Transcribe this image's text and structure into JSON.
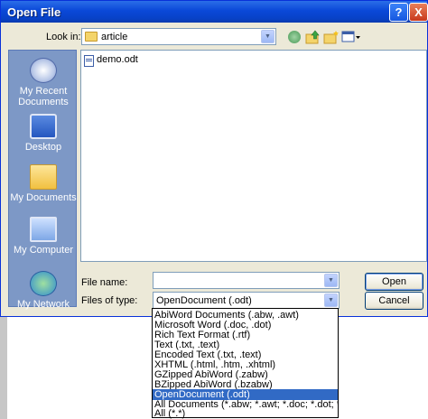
{
  "window": {
    "title": "Open File",
    "help_symbol": "?",
    "close_symbol": "X"
  },
  "lookin": {
    "label": "Look in:",
    "value": "article"
  },
  "toolbar": {
    "icons": [
      "back-icon",
      "up-folder-icon",
      "new-folder-icon",
      "view-menu-icon"
    ]
  },
  "places": [
    {
      "label": "My Recent Documents",
      "icon": "recent-documents-icon"
    },
    {
      "label": "Desktop",
      "icon": "desktop-icon"
    },
    {
      "label": "My Documents",
      "icon": "my-documents-icon"
    },
    {
      "label": "My Computer",
      "icon": "my-computer-icon"
    },
    {
      "label": "My Network",
      "icon": "my-network-icon"
    }
  ],
  "files": [
    {
      "name": "demo.odt",
      "icon": "document-icon"
    }
  ],
  "filename": {
    "label": "File name:",
    "value": ""
  },
  "filetype": {
    "label": "Files of type:",
    "value": "OpenDocument (.odt)",
    "options": [
      "AbiWord Documents (.abw, .awt)",
      "Microsoft Word (.doc, .dot)",
      "Rich Text Format (.rtf)",
      "Text (.txt, .text)",
      "Encoded Text (.txt, .text)",
      "XHTML (.html, .htm, .xhtml)",
      "GZipped AbiWord (.zabw)",
      "BZipped AbiWord (.bzabw)",
      "OpenDocument (.odt)",
      "All Documents (*.abw; *.awt; *.doc; *.dot; *.rtf; *.txt;",
      "All (*.*)"
    ],
    "selected_index": 8
  },
  "buttons": {
    "open": "Open",
    "cancel": "Cancel"
  },
  "colors": {
    "titlebar": "#0a48d8",
    "dialog_bg": "#ece9d8",
    "places_bar": "#7d98c6",
    "selection": "#316ac5"
  }
}
